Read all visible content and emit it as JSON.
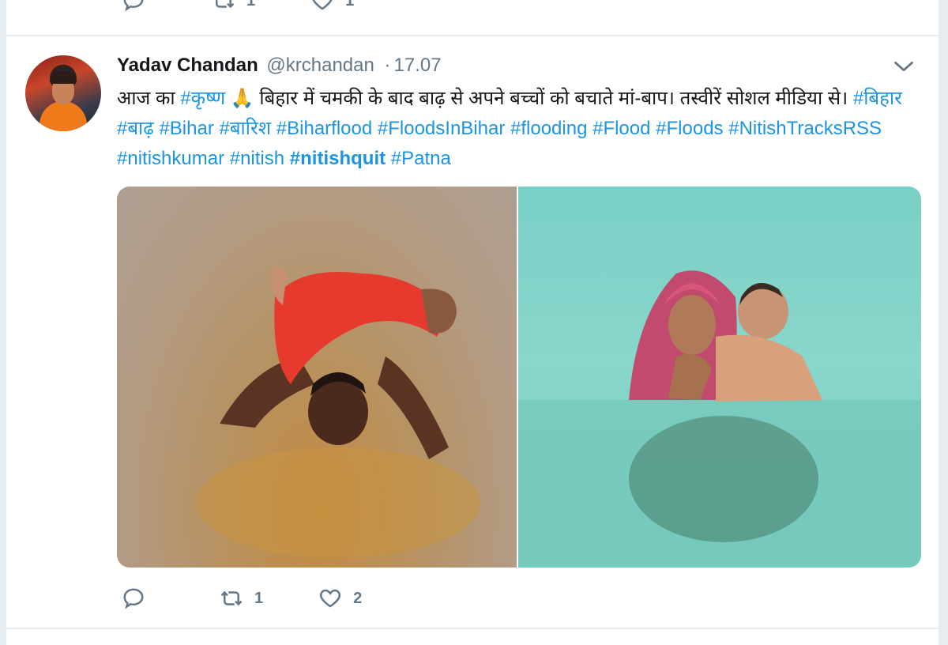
{
  "prev_tweet": {
    "reply_icon": "reply-icon",
    "retweet_icon": "retweet-icon",
    "like_icon": "like-icon",
    "retweet_count": "1",
    "like_count": "1"
  },
  "tweet": {
    "author_name": "Yadav Chandan",
    "handle": "@krchandan",
    "separator": "·",
    "time": "17.07",
    "avatar_icon": "avatar",
    "menu_icon": "chevron-down-icon",
    "text_intro": "आज का ",
    "tag_krishna": "#कृष्ण",
    "emoji": " 🙏 ",
    "text_body": "बिहार में चमकी के बाद बाढ़ से अपने बच्चों को बचाते मां-बाप। तस्वीरें सोशल मीडिया से। ",
    "hashtags": [
      "#बिहार",
      "#बाढ़",
      "#Bihar",
      "#बारिश",
      "#Biharflood",
      "#FloodsInBihar",
      "#flooding",
      "#Flood",
      "#Floods",
      "#NitishTracksRSS",
      "#nitishkumar",
      "#nitish",
      "#nitishquit",
      "#Patna"
    ],
    "media": {
      "left_alt": "man-holding-baby-above-flood-water",
      "right_alt": "mother-carrying-child-through-flood-water"
    },
    "actions": {
      "reply_count": "",
      "retweet_count": "1",
      "like_count": "2"
    }
  },
  "colors": {
    "link": "#1b95e0",
    "muted": "#657786",
    "text": "#14171a",
    "background": "#e6ecf0",
    "card": "#ffffff"
  }
}
